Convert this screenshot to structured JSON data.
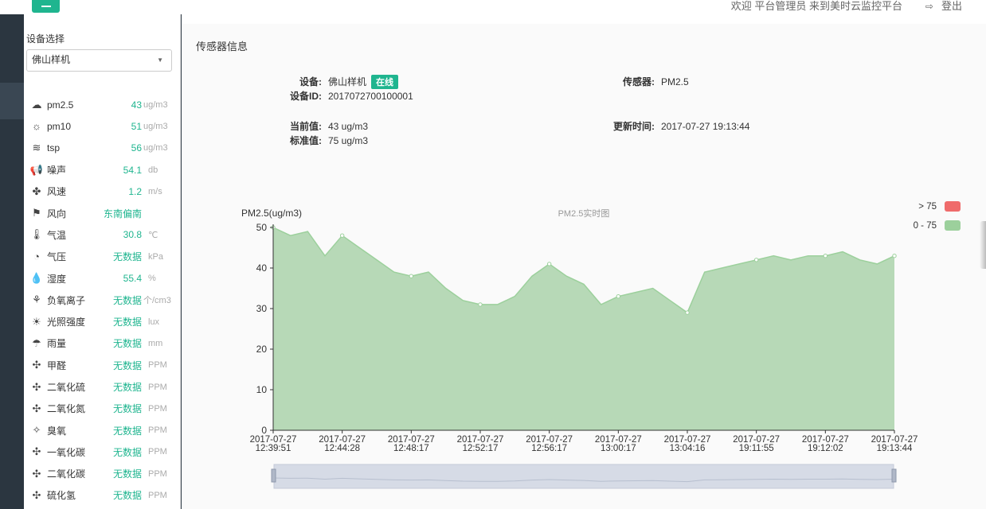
{
  "header": {
    "menu_icon": "hamburger-icon",
    "welcome_text": "欢迎 平台管理员 来到美时云监控平台",
    "logout_label": "登出",
    "logout_icon": "logout-icon",
    "accent_color": "#1fb58f"
  },
  "sidebar": {
    "device_select_label": "设备选择",
    "device_selected": "佛山样机",
    "sensors": [
      {
        "icon": "pm25-icon",
        "glyph": "☁",
        "name": "pm2.5",
        "value": "43",
        "unit": "ug/m3"
      },
      {
        "icon": "pm10-icon",
        "glyph": "☼",
        "name": "pm10",
        "value": "51",
        "unit": "ug/m3"
      },
      {
        "icon": "tsp-icon",
        "glyph": "≋",
        "name": "tsp",
        "value": "56",
        "unit": "ug/m3"
      },
      {
        "icon": "noise-icon",
        "glyph": "📢",
        "name": "噪声",
        "value": "54.1",
        "unit": "db"
      },
      {
        "icon": "wind-speed-icon",
        "glyph": "✤",
        "name": "风速",
        "value": "1.2",
        "unit": "m/s"
      },
      {
        "icon": "wind-direction-icon",
        "glyph": "⚑",
        "name": "风向",
        "value": "东南偏南",
        "unit": ""
      },
      {
        "icon": "temperature-icon",
        "glyph": "🌡",
        "name": "气温",
        "value": "30.8",
        "unit": "℃"
      },
      {
        "icon": "pressure-icon",
        "glyph": "◔",
        "name": "气压",
        "value": "无数据",
        "unit": "kPa"
      },
      {
        "icon": "humidity-icon",
        "glyph": "💧",
        "name": "湿度",
        "value": "55.4",
        "unit": "%"
      },
      {
        "icon": "negative-ion-icon",
        "glyph": "⚘",
        "name": "负氧离子",
        "value": "无数据",
        "unit": "个/cm3"
      },
      {
        "icon": "light-intensity-icon",
        "glyph": "☀",
        "name": "光照强度",
        "value": "无数据",
        "unit": "lux"
      },
      {
        "icon": "rainfall-icon",
        "glyph": "☂",
        "name": "雨量",
        "value": "无数据",
        "unit": "mm"
      },
      {
        "icon": "formaldehyde-icon",
        "glyph": "✣",
        "name": "甲醛",
        "value": "无数据",
        "unit": "PPM"
      },
      {
        "icon": "sulfur-dioxide-icon",
        "glyph": "✣",
        "name": "二氧化硫",
        "value": "无数据",
        "unit": "PPM"
      },
      {
        "icon": "nitrogen-dioxide-icon",
        "glyph": "✣",
        "name": "二氧化氮",
        "value": "无数据",
        "unit": "PPM"
      },
      {
        "icon": "ozone-icon",
        "glyph": "✧",
        "name": "臭氧",
        "value": "无数据",
        "unit": "PPM"
      },
      {
        "icon": "carbon-monoxide-icon",
        "glyph": "✣",
        "name": "一氧化碳",
        "value": "无数据",
        "unit": "PPM"
      },
      {
        "icon": "carbon-dioxide-icon",
        "glyph": "✣",
        "name": "二氧化碳",
        "value": "无数据",
        "unit": "PPM"
      },
      {
        "icon": "hydrogen-sulfide-icon",
        "glyph": "✣",
        "name": "硫化氢",
        "value": "无数据",
        "unit": "PPM"
      }
    ]
  },
  "main": {
    "panel_title": "传感器信息",
    "device_label": "设备:",
    "device_value": "佛山样机",
    "status_badge": "在线",
    "device_id_label": "设备ID:",
    "device_id_value": "2017072700100001",
    "sensor_label": "传感器:",
    "sensor_value": "PM2.5",
    "current_label": "当前值:",
    "current_value": "43 ug/m3",
    "standard_label": "标准值:",
    "standard_value": "75 ug/m3",
    "update_label": "更新时间:",
    "update_value": "2017-07-27 19:13:44"
  },
  "chart_data": {
    "type": "area",
    "title": "PM2.5实时图",
    "ylabel": "PM2.5(ug/m3)",
    "ylim": [
      0,
      50
    ],
    "yticks": [
      0,
      10,
      20,
      30,
      40,
      50
    ],
    "grid": false,
    "legend_placement": "top-right",
    "legend": [
      {
        "label": "> 75",
        "color": "#ef6b6b"
      },
      {
        "label": "0 - 75",
        "color": "#9cd09c"
      }
    ],
    "xtick_labels": [
      [
        "2017-07-27",
        "12:39:51"
      ],
      [
        "2017-07-27",
        "12:44:28"
      ],
      [
        "2017-07-27",
        "12:48:17"
      ],
      [
        "2017-07-27",
        "12:52:17"
      ],
      [
        "2017-07-27",
        "12:56:17"
      ],
      [
        "2017-07-27",
        "13:00:17"
      ],
      [
        "2017-07-27",
        "13:04:16"
      ],
      [
        "2017-07-27",
        "19:11:55"
      ],
      [
        "2017-07-27",
        "19:12:02"
      ],
      [
        "2017-07-27",
        "19:13:44"
      ]
    ],
    "values": [
      50,
      48,
      49,
      43,
      48,
      45,
      42,
      39,
      38,
      39,
      35,
      32,
      31,
      31,
      33,
      38,
      41,
      38,
      36,
      31,
      33,
      34,
      35,
      32,
      29,
      39,
      40,
      41,
      42,
      43,
      42,
      43,
      43,
      44,
      42,
      41,
      43
    ],
    "marked_points": [
      0,
      4,
      8,
      12,
      16,
      20,
      24,
      28,
      32,
      36
    ],
    "fill_color": "#b7d9b7",
    "line_color": "#9cd09c"
  }
}
